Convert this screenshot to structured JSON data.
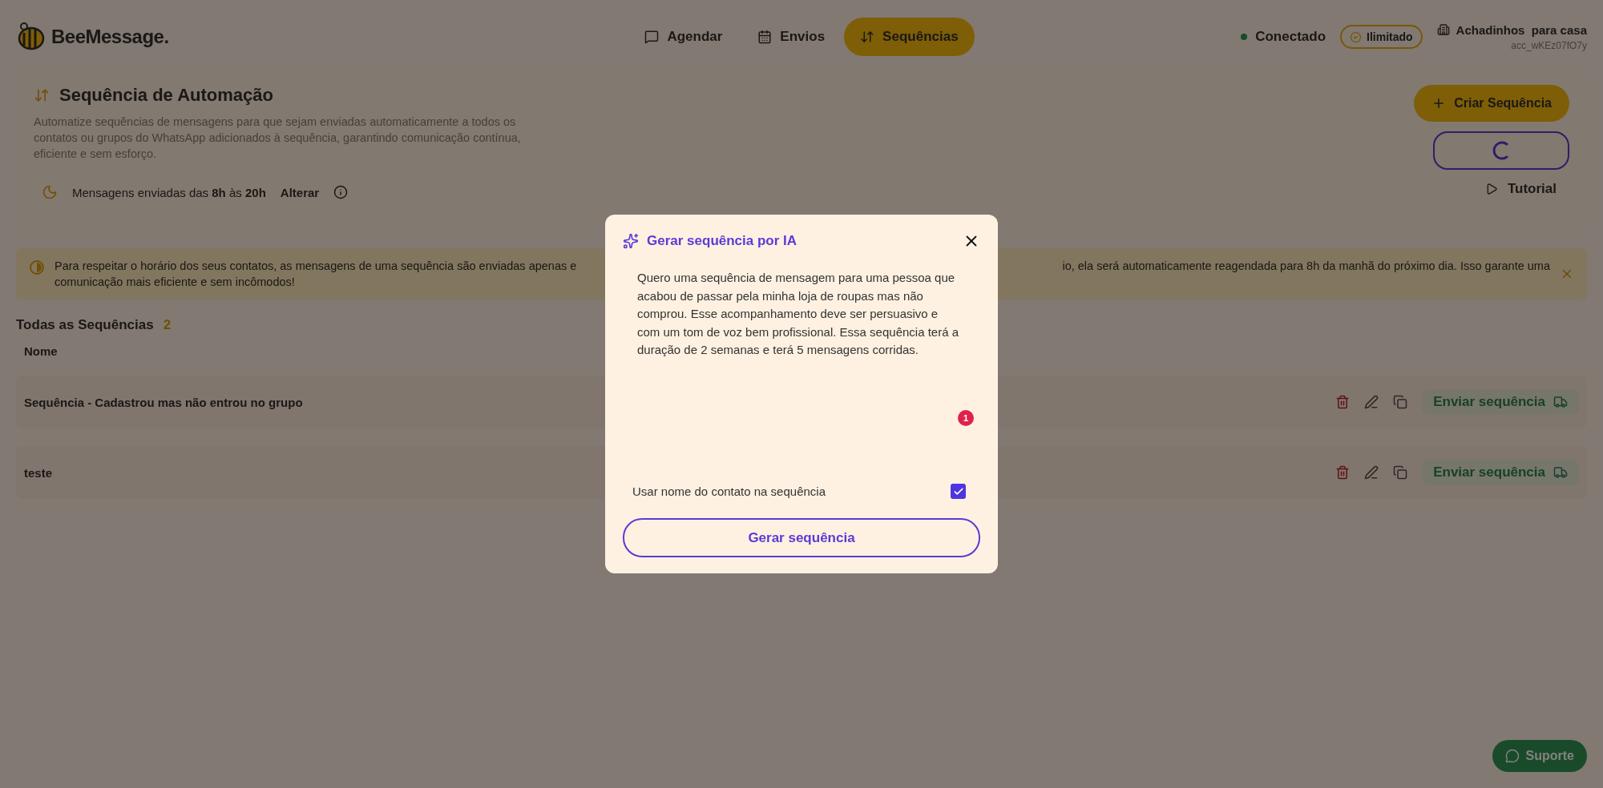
{
  "header": {
    "logo": "BeeMessage.",
    "nav": [
      {
        "label": "Agendar",
        "kind": "message",
        "selected": false
      },
      {
        "label": "Envios",
        "kind": "calendar",
        "selected": false
      },
      {
        "label": "Sequências",
        "kind": "sequence",
        "selected": true
      }
    ],
    "status": "Conectado",
    "plan": "Ilimitado",
    "account": {
      "name": "Achadinhos  para casa",
      "id": "acc_wKEz07fO7y"
    }
  },
  "automation": {
    "title": "Sequência de Automação",
    "description": "Automatize sequências de mensagens para que sejam enviadas automaticamente a todos os contatos ou grupos do WhatsApp adicionados à sequência, garantindo comunicação contínua, eficiente e sem esforço.",
    "hours": "Mensagens enviadas das **8h** às **20h**",
    "change_link": "Alterar",
    "create_button": "Criar Sequência",
    "loading": true,
    "tutorial": "Tutorial"
  },
  "notice": {
    "text_left": "Para respeitar o horário dos seus contatos, as mensagens de uma sequência são enviadas apenas e",
    "text_right": "io, ela será automaticamente reagendada para 8h da manhã do próximo dia. Isso garante uma",
    "text_line2": "comunicação mais eficiente e sem incômodos!"
  },
  "sequences": {
    "title": "Todas as Sequências",
    "count": "2",
    "column": "Nome",
    "rows": [
      {
        "name": "Sequência - Cadastrou mas não entrou no grupo",
        "send_button": "Enviar sequência"
      },
      {
        "name": "teste",
        "send_button": "Enviar sequência"
      }
    ]
  },
  "modal": {
    "title": "Gerar sequência por IA",
    "prompt": "Quero uma sequência de mensagem para uma pessoa que acabou de passar pela minha loja de roupas mas não comprou. Esse acompanhamento deve ser persuasivo e com um tom de voz bem profissional. Essa sequência terá a duração de 2 semanas e terá 5 mensagens corridas.",
    "badge": "1",
    "option": {
      "label": "Usar nome do contato na sequência",
      "checked": true
    },
    "submit": "Gerar sequência"
  },
  "support_button": "Suporte"
}
